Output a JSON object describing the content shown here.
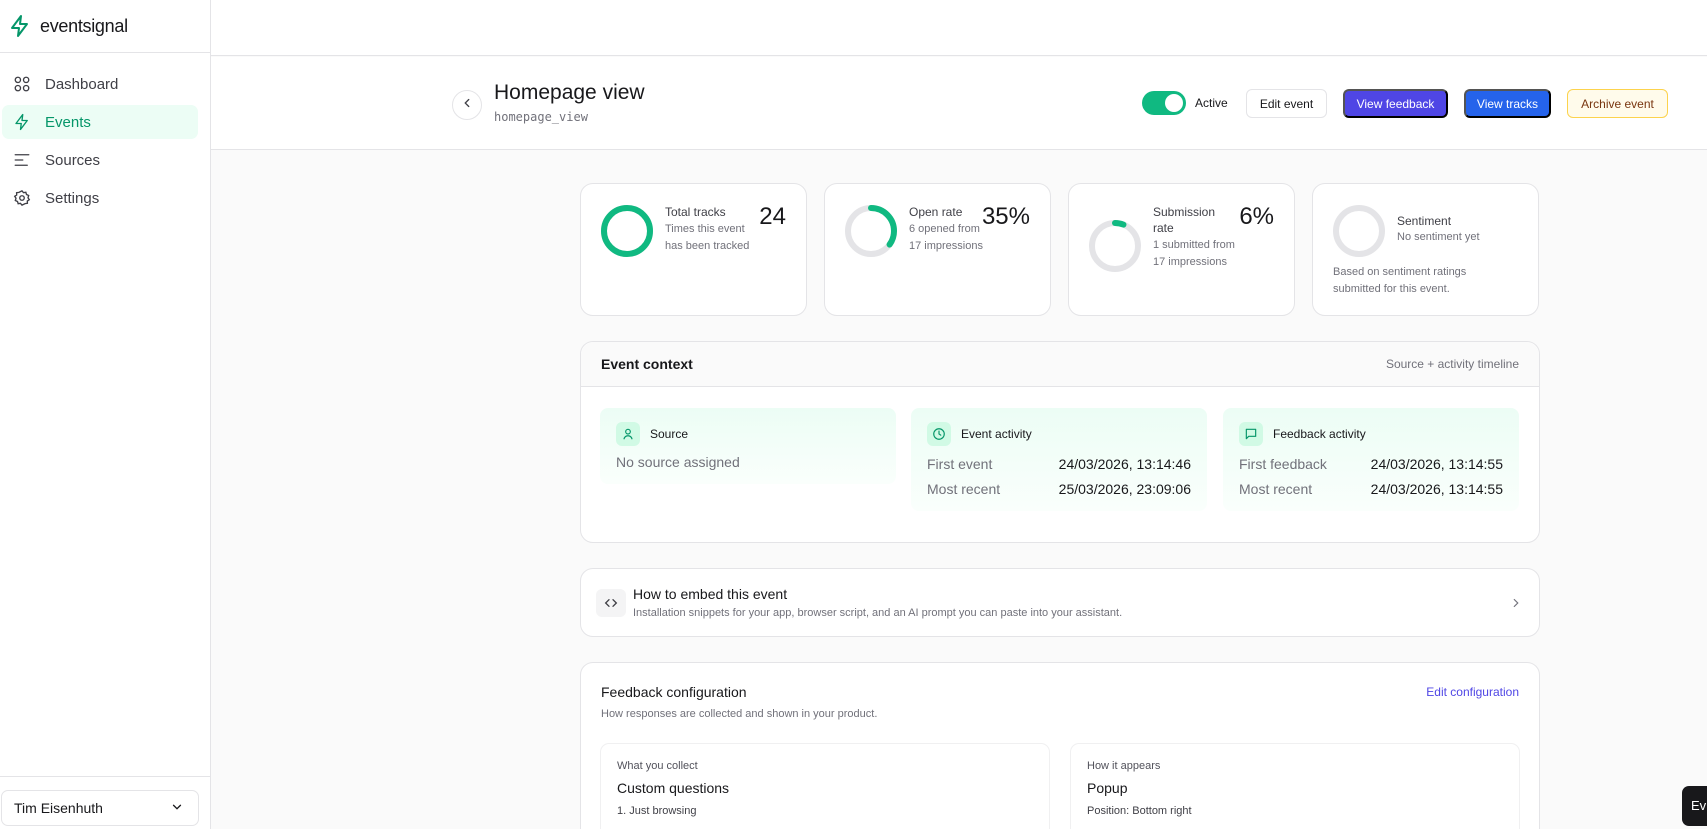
{
  "brand": {
    "name": "eventsignal"
  },
  "sidebar": {
    "items": [
      {
        "label": "Dashboard",
        "icon": "grid-icon"
      },
      {
        "label": "Events",
        "icon": "bolt-icon",
        "active": true
      },
      {
        "label": "Sources",
        "icon": "lines-icon"
      },
      {
        "label": "Settings",
        "icon": "gear-icon"
      }
    ],
    "user": "Tim Eisenhuth"
  },
  "header": {
    "title": "Homepage view",
    "slug": "homepage_view",
    "active_label": "Active",
    "active": true,
    "buttons": {
      "edit": "Edit event",
      "feedback": "View feedback",
      "tracks": "View tracks",
      "archive": "Archive event"
    }
  },
  "stats": [
    {
      "label": "Total tracks",
      "sub": "Times this event has been tracked",
      "value": "24",
      "fraction": 1.0
    },
    {
      "label": "Open rate",
      "sub": "6 opened from 17 impressions",
      "value": "35%",
      "fraction": 0.35
    },
    {
      "label": "Submission rate",
      "sub": "1 submitted from 17 impressions",
      "value": "6%",
      "fraction": 0.06
    },
    {
      "label": "Sentiment",
      "sub": "No sentiment yet",
      "note": "Based on sentiment ratings submitted for this event.",
      "fraction": 0
    }
  ],
  "context": {
    "title": "Event context",
    "right": "Source + activity timeline",
    "source": {
      "title": "Source",
      "empty": "No source assigned"
    },
    "event_activity": {
      "title": "Event activity",
      "first_label": "First event",
      "first_value": "24/03/2026, 13:14:46",
      "recent_label": "Most recent",
      "recent_value": "25/03/2026, 23:09:06"
    },
    "feedback_activity": {
      "title": "Feedback activity",
      "first_label": "First feedback",
      "first_value": "24/03/2026, 13:14:55",
      "recent_label": "Most recent",
      "recent_value": "24/03/2026, 13:14:55"
    }
  },
  "embed": {
    "title": "How to embed this event",
    "desc": "Installation snippets for your app, browser script, and an AI prompt you can paste into your assistant."
  },
  "feedback_config": {
    "title": "Feedback configuration",
    "desc": "How responses are collected and shown in your product.",
    "edit_link": "Edit configuration",
    "collect": {
      "caption": "What you collect",
      "value": "Custom questions",
      "first_item": "1. Just browsing"
    },
    "appears": {
      "caption": "How it appears",
      "value": "Popup",
      "position": "Position: Bottom right"
    }
  },
  "corner_button": "Ev",
  "colors": {
    "accent": "#10b981",
    "indigo": "#4f46e5",
    "blue": "#2563eb"
  }
}
